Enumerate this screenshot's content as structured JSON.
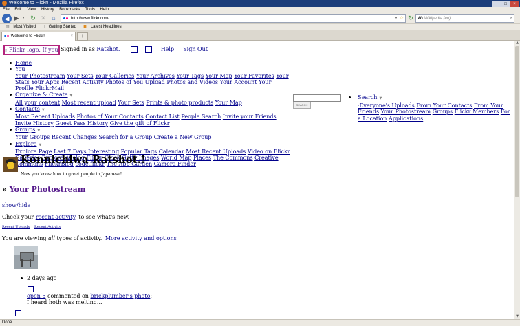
{
  "browser": {
    "title": "Welcome to Flickr! - Mozilla Firefox",
    "menu": [
      "File",
      "Edit",
      "View",
      "History",
      "Bookmarks",
      "Tools",
      "Help"
    ],
    "url": "http://www.flickr.com/",
    "search_placeholder": "Wikipedia (en)",
    "bookmarks": [
      "Most Visited",
      "Getting Started",
      "Latest Headlines"
    ],
    "tab_title": "Welcome to Flickr!",
    "status": "Done"
  },
  "header": {
    "logo_text": "Flickr logo. If you",
    "signed_in_prefix": "Signed in as",
    "username": "Ratshot.",
    "help": "Help",
    "sign_out": "Sign Out"
  },
  "nav": {
    "home": "Home",
    "you": "You",
    "you_links": [
      "Your Photostream",
      "Your Sets",
      "Your Galleries",
      "Your Archives",
      "Your Tags",
      "Your Map",
      "Your Favorites",
      "Your Stats",
      "Your Apps",
      "Recent Activity",
      "Photos of You",
      "Upload Photos and Videos",
      "Your Account",
      "Your Profile",
      "FlickrMail"
    ],
    "organize": "Organize & Create",
    "organize_links": [
      "All your content",
      "Most recent upload",
      "Your Sets",
      "Prints & photo products",
      "Your Map"
    ],
    "contacts": "Contacts",
    "contacts_links": [
      "Most Recent Uploads",
      "Photos of Your Contacts",
      "Contact List",
      "People Search",
      "Invite your Friends",
      "Invite History",
      "Guest Pass History",
      "Give the gift of Flickr"
    ],
    "groups": "Groups",
    "groups_links": [
      "Your Groups",
      "Recent Changes",
      "Search for a Group",
      "Create a New Group"
    ],
    "explore": "Explore",
    "explore_links": [
      "Explore Page",
      "Last 7 Days Interesting",
      "Popular Tags",
      "Calendar",
      "Most Recent Uploads",
      "Video on Flickr",
      "Galleries",
      "Explore Analog",
      "Flickr Clock",
      "Getty Images",
      "World Map",
      "Places",
      "The Commons",
      "Creative Commons",
      "FlickrBlog",
      "code.flickr",
      "The App Garden",
      "Camera Finder"
    ]
  },
  "search": {
    "button": "SEARCH",
    "title": "Search",
    "links": [
      "Everyone's Uploads",
      "From Your Contacts",
      "From Your Friends",
      "Your Photostream",
      "Groups",
      "Flickr Members",
      "For a Location",
      "Applications"
    ]
  },
  "greeting": {
    "title": "Konnichiwa Ratshot.!",
    "subtitle": "Now you know how to greet people in Japanese!"
  },
  "photostream": {
    "prefix": "»",
    "title": "Your Photostream",
    "show_hide": "show/hide",
    "check_prefix": "Check your",
    "recent_activity": "recent activity",
    "check_suffix": ", to see what's new.",
    "recent_uploads": "Recent Uploads",
    "recent_activity_small": "Recent Activity",
    "viewing_prefix": "You are viewing",
    "viewing_em": "all",
    "viewing_suffix": "types of activity.",
    "more_link": "More activity and options"
  },
  "activity": {
    "time_ago": "2 days ago",
    "user": "open 5",
    "commented_on": "commented on",
    "photo_link": "brickplumber's photo",
    "colon": ":",
    "comment": "I heard hoth was melting..."
  }
}
